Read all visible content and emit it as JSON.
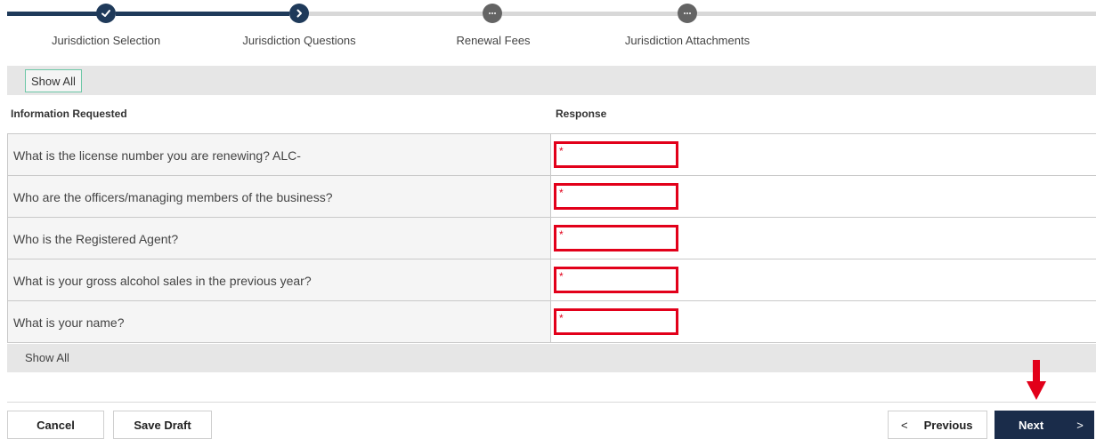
{
  "stepper": {
    "steps": [
      {
        "label": "Jurisdiction Selection",
        "status": "complete",
        "icon": "check-icon"
      },
      {
        "label": "Jurisdiction Questions",
        "status": "current",
        "icon": "chevron-right-icon"
      },
      {
        "label": "Renewal Fees",
        "status": "pending",
        "icon": "ellipsis-icon"
      },
      {
        "label": "Jurisdiction Attachments",
        "status": "pending",
        "icon": "ellipsis-icon"
      }
    ]
  },
  "show_all_label": "Show All",
  "table": {
    "headers": {
      "question": "Information Requested",
      "response": "Response"
    },
    "rows": [
      {
        "question": "What is the license number you are renewing? ALC-",
        "required_marker": "*",
        "value": ""
      },
      {
        "question": "Who are the officers/managing members of the business?",
        "required_marker": "*",
        "value": ""
      },
      {
        "question": "Who is the Registered Agent?",
        "required_marker": "*",
        "value": ""
      },
      {
        "question": "What is your gross alcohol sales in the previous year?",
        "required_marker": "*",
        "value": ""
      },
      {
        "question": "What is your name?",
        "required_marker": "*",
        "value": ""
      }
    ]
  },
  "footer": {
    "cancel_label": "Cancel",
    "save_draft_label": "Save Draft",
    "previous_label": "Previous",
    "next_label": "Next",
    "previous_icon": "<",
    "next_icon": ">"
  },
  "colors": {
    "stepper_complete": "#1f3a5a",
    "stepper_pending": "#646464",
    "highlight": "#e2001a",
    "next_button": "#1a2c4a"
  }
}
